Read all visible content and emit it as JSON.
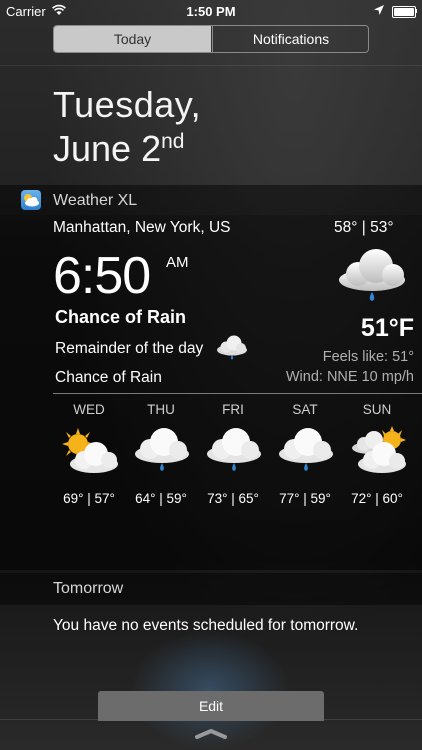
{
  "status_bar": {
    "carrier": "Carrier",
    "time": "1:50 PM"
  },
  "segmented": {
    "today": "Today",
    "notifications": "Notifications"
  },
  "date": {
    "weekday": "Tuesday,",
    "month_day": "June 2",
    "suffix": "nd"
  },
  "widget": {
    "app_name": "Weather XL",
    "location": "Manhattan, New York, US",
    "hilo": "58°   |   53°",
    "clock": "6:50",
    "ampm": "AM",
    "current_temp": "51°F",
    "condition_title": "Chance of Rain",
    "remainder": "Remainder of the day",
    "feels_like": "Feels like: 51°",
    "condition_2": "Chance of Rain",
    "wind": "Wind: NNE 10 mp/h",
    "forecast": [
      {
        "day": "WED",
        "icon": "partly-sunny-icon",
        "temps": "69° | 57°"
      },
      {
        "day": "THU",
        "icon": "rain-cloud-icon",
        "temps": "64° | 59°"
      },
      {
        "day": "FRI",
        "icon": "rain-cloud-icon",
        "temps": "73° | 65°"
      },
      {
        "day": "SAT",
        "icon": "rain-cloud-icon",
        "temps": "77° | 59°"
      },
      {
        "day": "SUN",
        "icon": "sun-clouds-icon",
        "temps": "72° | 60°"
      }
    ]
  },
  "tomorrow": {
    "label": "Tomorrow",
    "message": "You have no events scheduled for tomorrow."
  },
  "edit_label": "Edit",
  "colors": {
    "rain_drop": "#2e86d4",
    "sun": "#f6b21b"
  }
}
